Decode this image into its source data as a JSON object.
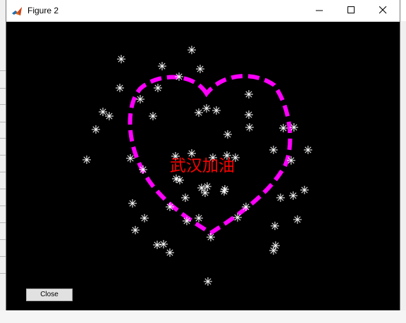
{
  "window": {
    "title": "Figure 2",
    "background": "#000000"
  },
  "controls": {
    "close_label": "Close"
  },
  "plot": {
    "text": "武汉加油",
    "text_color": "#ff0000",
    "heart_color": "#ff00ff",
    "star_color": "#ffffff",
    "heart_style": "dashed"
  },
  "icons": {
    "app": "matlab-icon",
    "minimize": "minimize-icon",
    "maximize": "maximize-icon",
    "close": "close-icon"
  }
}
